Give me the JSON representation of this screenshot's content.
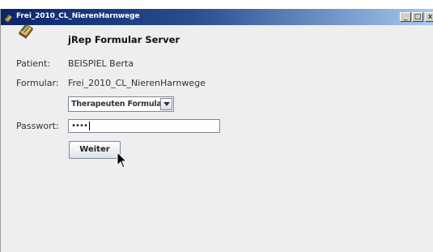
{
  "window": {
    "title": "Frei_2010_CL_NierenHarnwege",
    "controls": {
      "minimize": "_",
      "maximize": "□",
      "close": "x"
    }
  },
  "app": {
    "title": "jRep Formular Server",
    "logo_icon": "book-icon"
  },
  "form": {
    "patient_label": "Patient:",
    "patient_value": "BEISPIEL Berta",
    "formular_label": "Formular:",
    "formular_value": "Frei_2010_CL_NierenHarnwege",
    "form_type_selected": "Therapeuten Formular",
    "password_label": "Passwort:",
    "password_masked": "••••",
    "submit_label": "Weiter"
  },
  "colors": {
    "titlebar_start": "#0a246a",
    "titlebar_end": "#a6caf0",
    "window_bg": "#eeeeee"
  }
}
